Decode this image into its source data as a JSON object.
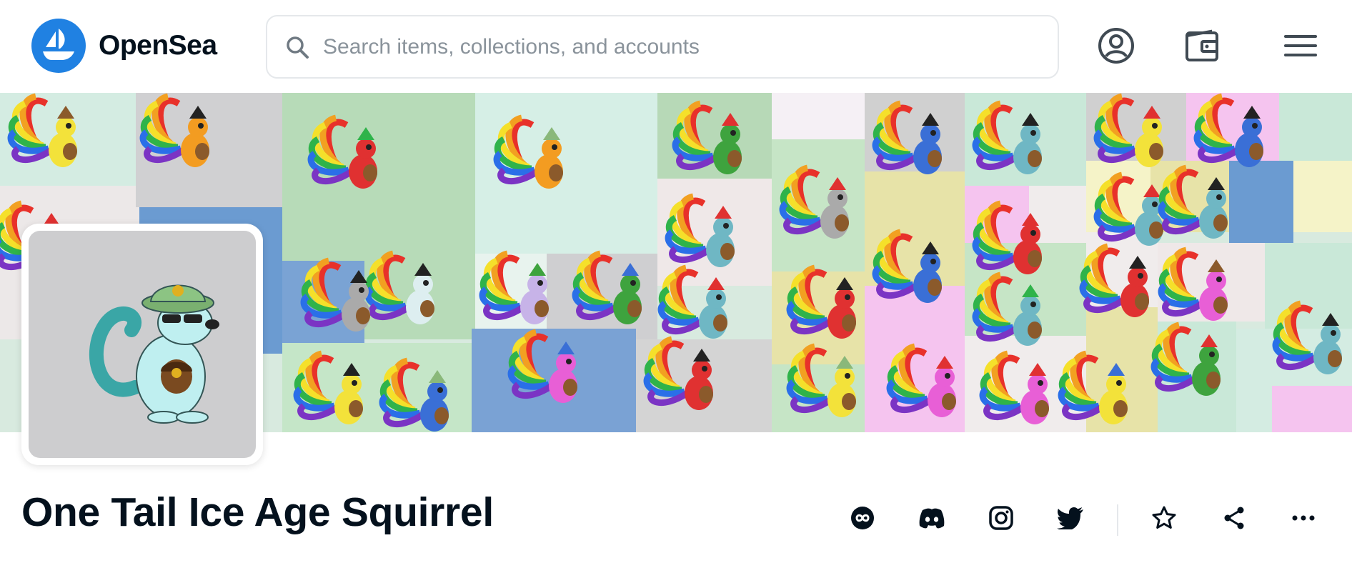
{
  "brand": {
    "name": "OpenSea",
    "color": "#2081e2"
  },
  "search": {
    "placeholder": "Search items, collections, and accounts",
    "value": ""
  },
  "header_icons": [
    "profile-icon",
    "wallet-icon",
    "menu-icon"
  ],
  "collection": {
    "title": "One Tail Ice Age Squirrel"
  },
  "actions": [
    "website-icon",
    "discord-icon",
    "instagram-icon",
    "twitter-icon",
    "star-icon",
    "share-icon",
    "more-icon"
  ]
}
